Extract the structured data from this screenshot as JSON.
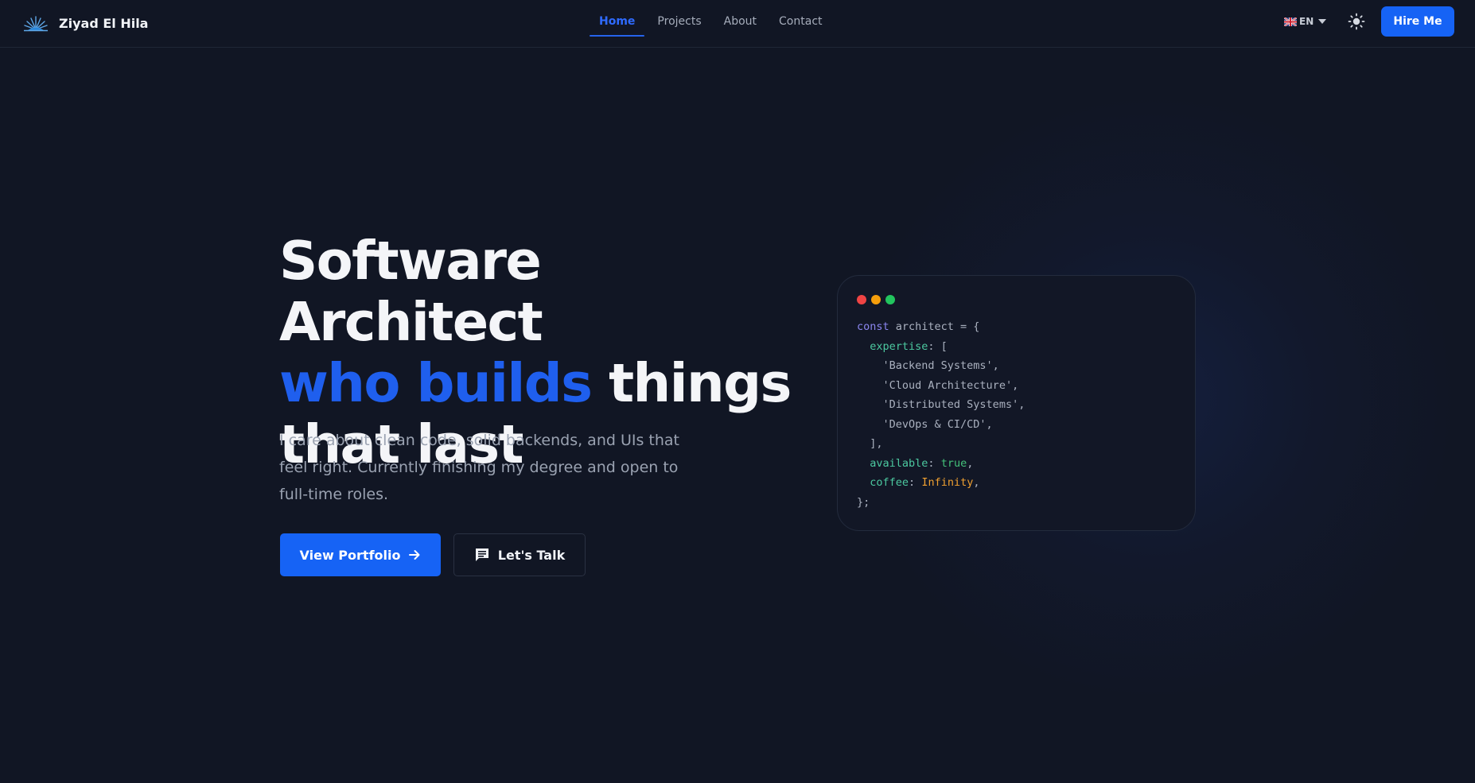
{
  "nav": {
    "brand": "Ziyad El Hila",
    "links": [
      {
        "label": "Home",
        "active": true
      },
      {
        "label": "Projects",
        "active": false
      },
      {
        "label": "About",
        "active": false
      },
      {
        "label": "Contact",
        "active": false
      }
    ],
    "language": "EN",
    "language_icon": "uk-flag-icon",
    "theme_icon": "sun-icon",
    "hire_button": "Hire Me"
  },
  "hero": {
    "title_line1": "Software Architect",
    "title_accent": "who builds",
    "title_line2_rest": " things",
    "title_line3": "that last",
    "subtitle": "I care about clean code, solid backends, and UIs that feel right. Currently finishing my degree and open to full-time roles.",
    "primary_button": "View Portfolio",
    "primary_icon": "arrow-right-icon",
    "secondary_button": "Let's Talk",
    "secondary_icon": "chat-icon"
  },
  "code_card": {
    "keyword": "const",
    "identifier": " architect = {",
    "expertise_key": "expertise",
    "expertise_open": ": [",
    "expertise_items": [
      "'Backend Systems',",
      "'Cloud Architecture',",
      "'Distributed Systems',",
      "'DevOps & CI/CD',"
    ],
    "expertise_close": "],",
    "available_key": "available",
    "available_value": "true",
    "coffee_key": "coffee",
    "coffee_value": "Infinity",
    "closing": "};"
  },
  "colors": {
    "background": "#111624",
    "accent": "#1663f5",
    "dot_red": "#ef4444",
    "dot_yellow": "#f59e0b",
    "dot_green": "#22c55e"
  }
}
